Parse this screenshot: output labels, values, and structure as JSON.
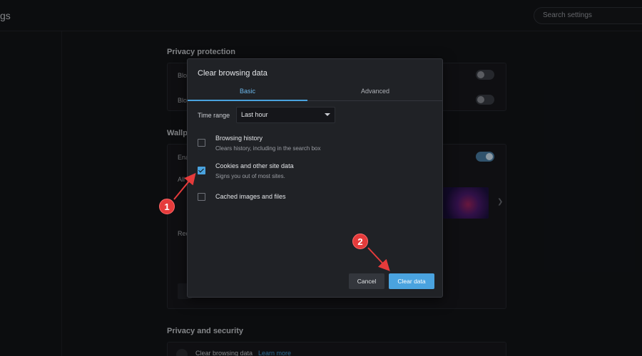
{
  "app": {
    "title_fragment": "gs"
  },
  "search": {
    "placeholder": "Search settings"
  },
  "background": {
    "privacy_protection_title": "Privacy protection",
    "row1_fragment": "Blo",
    "row2_fragment": "Blo",
    "wallpaper_title_fragment": "Wallp",
    "wallpaper_row1_fragment": "Ena",
    "wallpaper_row2_fragment": "All",
    "wallpaper_row3_fragment": "Rec",
    "privacy_security_title": "Privacy and security",
    "clear_browsing_label": "Clear browsing data",
    "learn_more_label": "Learn more"
  },
  "dialog": {
    "title": "Clear browsing data",
    "tabs": [
      {
        "label": "Basic",
        "active": true
      },
      {
        "label": "Advanced",
        "active": false
      }
    ],
    "time_range": {
      "label": "Time range",
      "value": "Last hour"
    },
    "options": [
      {
        "label": "Browsing history",
        "description": "Clears history, including in the search box",
        "checked": false
      },
      {
        "label": "Cookies and other site data",
        "description": "Signs you out of most sites.",
        "checked": true
      },
      {
        "label": "Cached images and files",
        "description": "",
        "checked": false
      }
    ],
    "cancel_label": "Cancel",
    "clear_label": "Clear data"
  },
  "annotations": {
    "step1": "1",
    "step2": "2"
  },
  "colors": {
    "accent": "#4aa3df",
    "annotation": "#e53b3b",
    "background": "#131418",
    "dialog": "#202226"
  }
}
